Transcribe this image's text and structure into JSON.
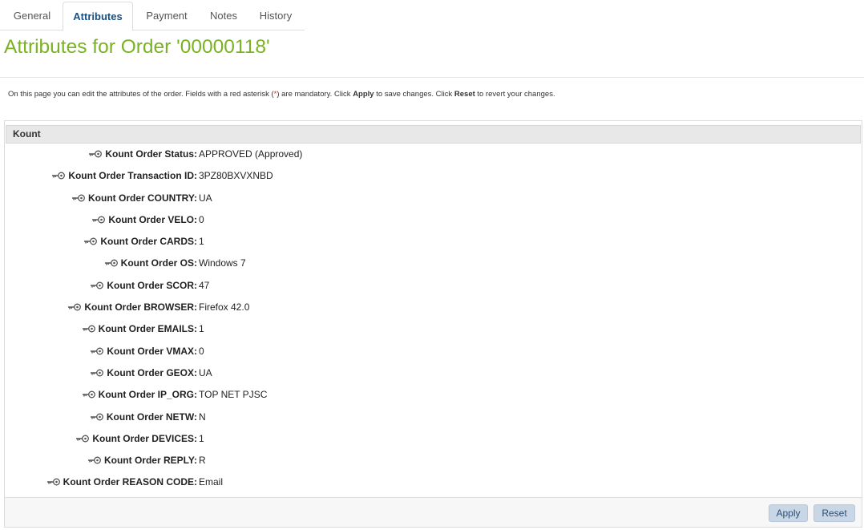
{
  "tabs": [
    {
      "label": "General",
      "active": false
    },
    {
      "label": "Attributes",
      "active": true
    },
    {
      "label": "Payment",
      "active": false
    },
    {
      "label": "Notes",
      "active": false
    },
    {
      "label": "History",
      "active": false
    }
  ],
  "page": {
    "title": "Attributes for Order '00000118'",
    "help": {
      "part1": "On this page you can edit the attributes of the order. Fields with a red asterisk (",
      "star": "*",
      "part2": ") are mandatory. Click ",
      "apply": "Apply",
      "part3": " to save changes. Click ",
      "reset": "Reset",
      "part4": " to revert your changes."
    }
  },
  "panel": {
    "header": "Kount",
    "rows": [
      {
        "label": "Kount Order Status:",
        "value": "APPROVED (Approved)"
      },
      {
        "label": "Kount Order Transaction ID:",
        "value": "3PZ80BXVXNBD"
      },
      {
        "label": "Kount Order COUNTRY:",
        "value": "UA"
      },
      {
        "label": "Kount Order VELO:",
        "value": "0"
      },
      {
        "label": "Kount Order CARDS:",
        "value": "1"
      },
      {
        "label": "Kount Order OS:",
        "value": "Windows 7"
      },
      {
        "label": "Kount Order SCOR:",
        "value": "47"
      },
      {
        "label": "Kount Order BROWSER:",
        "value": "Firefox 42.0"
      },
      {
        "label": "Kount Order EMAILS:",
        "value": "1"
      },
      {
        "label": "Kount Order VMAX:",
        "value": "0"
      },
      {
        "label": "Kount Order GEOX:",
        "value": "UA"
      },
      {
        "label": "Kount Order IP_ORG:",
        "value": "TOP NET PJSC"
      },
      {
        "label": "Kount Order NETW:",
        "value": "N"
      },
      {
        "label": "Kount Order DEVICES:",
        "value": "1"
      },
      {
        "label": "Kount Order REPLY:",
        "value": "R"
      },
      {
        "label": "Kount Order REASON CODE:",
        "value": "Email"
      }
    ],
    "buttons": {
      "apply": "Apply",
      "reset": "Reset"
    }
  },
  "icons": {
    "row_icon": "key-icon"
  },
  "colors": {
    "title": "#7bb125",
    "active_tab": "#1b4f82",
    "asterisk": "#c0392b",
    "button_bg": "#c9d6e6"
  }
}
